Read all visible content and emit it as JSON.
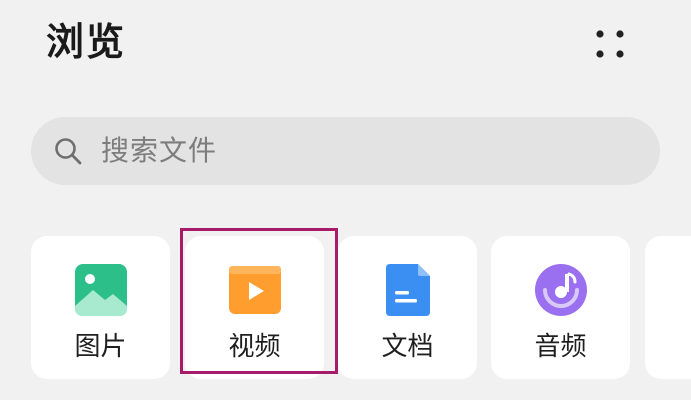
{
  "header": {
    "title": "浏览",
    "more_icon": "more-dots-icon"
  },
  "search": {
    "placeholder": "搜索文件",
    "icon": "search-icon"
  },
  "categories": [
    {
      "label": "图片",
      "icon": "image-icon",
      "color": "#2cbf8a"
    },
    {
      "label": "视频",
      "icon": "video-play-icon",
      "color": "#ff9d2e"
    },
    {
      "label": "文档",
      "icon": "document-icon",
      "color": "#3b8ff3"
    },
    {
      "label": "音频",
      "icon": "music-disc-icon",
      "color": "#9a6ff0"
    }
  ],
  "highlight": {
    "target": "视频",
    "color": "#a81b6b"
  }
}
